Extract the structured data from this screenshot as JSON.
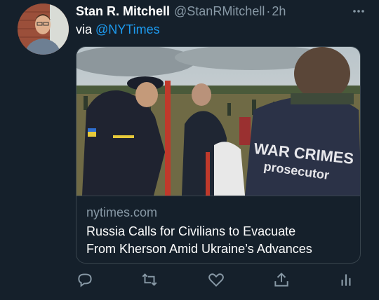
{
  "tweet": {
    "display_name": "Stan R. Mitchell",
    "handle": "@StanRMitchell",
    "separator": "·",
    "time": "2h",
    "via_prefix": "via",
    "via_link": "@NYTimes"
  },
  "card": {
    "domain": "nytimes.com",
    "title_line1": "Russia Calls for Civilians to Evacuate",
    "title_line2": "From Kherson Amid Ukraine’s Advances",
    "image_text_line1": "WAR CRIMES",
    "image_text_line2": "prosecutor"
  },
  "actions": {
    "reply_icon": "reply-icon",
    "retweet_icon": "retweet-icon",
    "like_icon": "heart-icon",
    "share_icon": "share-icon",
    "analytics_icon": "analytics-icon"
  },
  "colors": {
    "background": "#15202b",
    "accent": "#1d9bf0",
    "muted": "#8899a6",
    "border": "#38444d"
  }
}
